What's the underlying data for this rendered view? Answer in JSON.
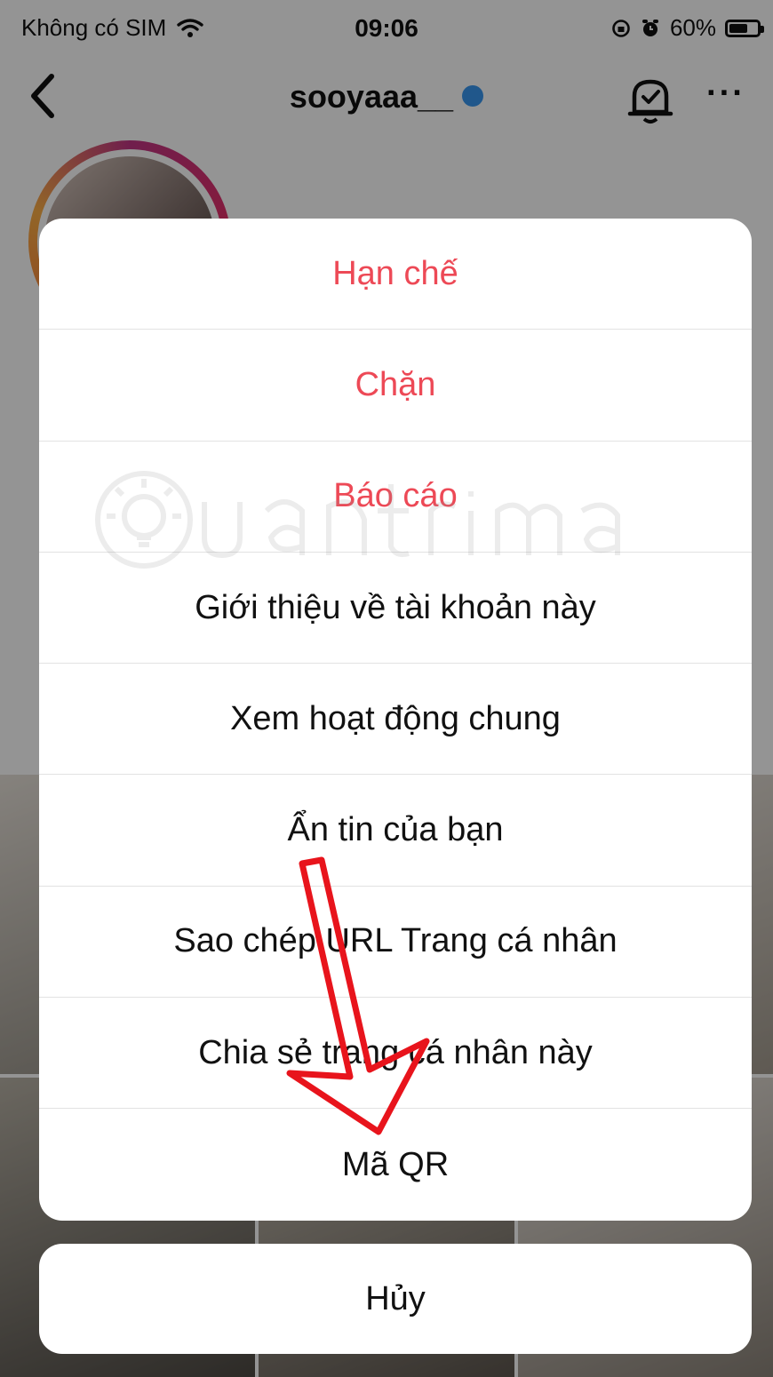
{
  "status_bar": {
    "carrier": "Không có SIM",
    "time": "09:06",
    "battery_pct": "60%",
    "icons": [
      "wifi-icon",
      "lock-rotation-icon",
      "alarm-icon",
      "battery-icon"
    ]
  },
  "profile": {
    "username": "sooyaaa__",
    "verified": true
  },
  "action_sheet": {
    "options": [
      {
        "label": "Hạn chế",
        "style": "destructive"
      },
      {
        "label": "Chặn",
        "style": "destructive"
      },
      {
        "label": "Báo cáo",
        "style": "destructive"
      },
      {
        "label": "Giới thiệu về tài khoản này",
        "style": "default"
      },
      {
        "label": "Xem hoạt động chung",
        "style": "default"
      },
      {
        "label": "Ẩn tin của bạn",
        "style": "default"
      },
      {
        "label": "Sao chép URL Trang cá nhân",
        "style": "default"
      },
      {
        "label": "Chia sẻ trang cá nhân này",
        "style": "default"
      },
      {
        "label": "Mã QR",
        "style": "default"
      }
    ],
    "cancel_label": "Hủy"
  },
  "colors": {
    "destructive": "#ed4956",
    "verified_badge": "#3897f0",
    "annotation_arrow": "#e8141c"
  }
}
